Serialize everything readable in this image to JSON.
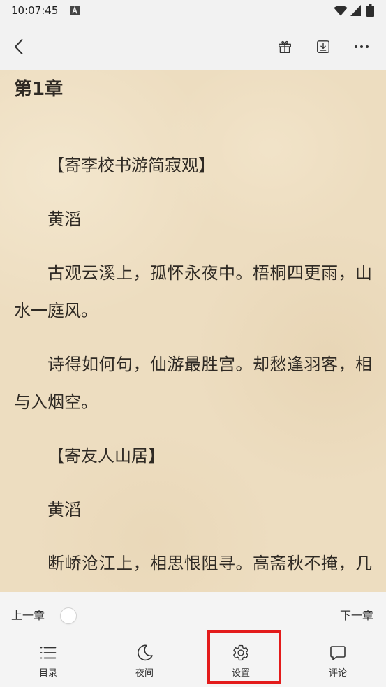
{
  "status_bar": {
    "time": "10:07:45",
    "notification_icon": "notification-a-icon",
    "wifi_icon": "wifi-icon",
    "signal_icon": "signal-icon",
    "battery_icon": "battery-icon"
  },
  "app_bar": {
    "back_icon": "chevron-left-icon",
    "actions": [
      {
        "icon": "gift-icon"
      },
      {
        "icon": "download-icon"
      },
      {
        "icon": "more-horizontal-icon"
      }
    ]
  },
  "reader": {
    "theme_background": "#edddc0",
    "text_color": "#2f2a24",
    "chapter_title": "第1章",
    "paragraphs": [
      "【寄李校书游简寂观】",
      "黄滔",
      "古观云溪上，孤怀永夜中。梧桐四更雨，山水一庭风。",
      "诗得如何句，仙游最胜宫。却愁逢羽客，相与入烟空。",
      "【寄友人山居】",
      "黄滔",
      "断峤沧江上，相思恨阻寻。高斋秋不掩，几"
    ]
  },
  "chapter_nav": {
    "prev_label": "上一章",
    "next_label": "下一章",
    "progress": 0
  },
  "bottom_nav": {
    "items": [
      {
        "label": "目录",
        "icon": "list-icon"
      },
      {
        "label": "夜间",
        "icon": "moon-icon"
      },
      {
        "label": "设置",
        "icon": "gear-icon"
      },
      {
        "label": "评论",
        "icon": "comment-icon"
      }
    ]
  },
  "highlight": {
    "color": "#e31b1b"
  }
}
